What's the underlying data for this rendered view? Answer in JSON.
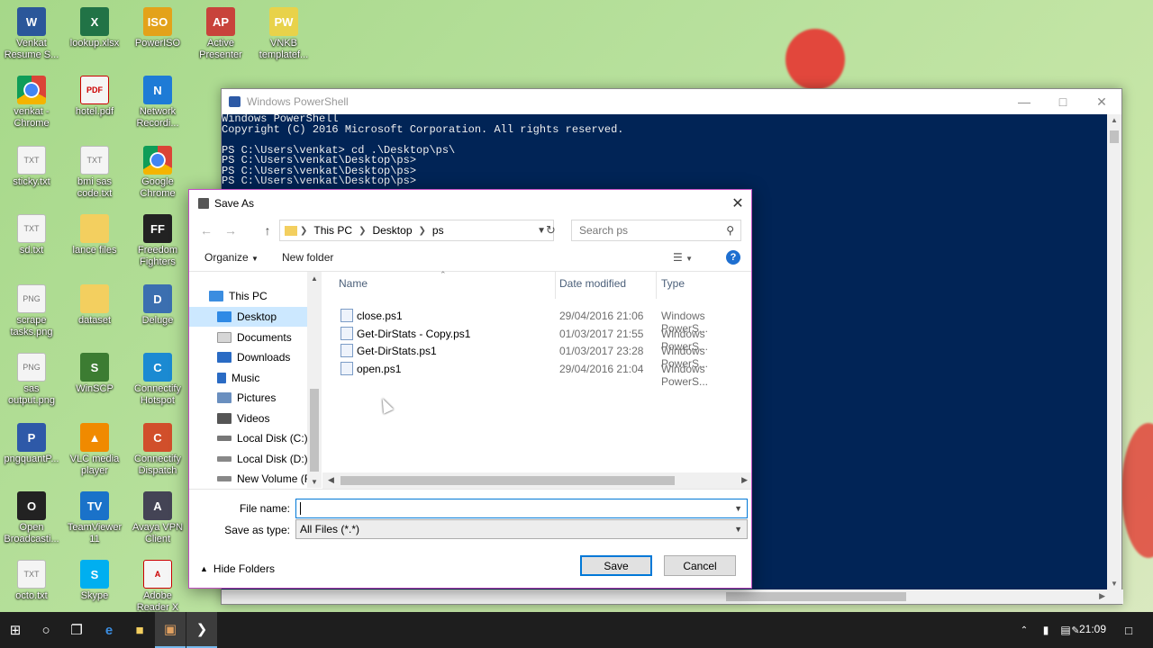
{
  "desktop": {
    "icons": [
      {
        "label": "Venkat Resume S...",
        "glyph": "W"
      },
      {
        "label": "lookup.xlsx",
        "glyph": "X"
      },
      {
        "label": "PowerISO",
        "glyph": "ISO"
      },
      {
        "label": "Active Presenter",
        "glyph": "AP"
      },
      {
        "label": "VNKB templatef...",
        "glyph": "PW"
      },
      {
        "label": "venkat - Chrome",
        "glyph": ""
      },
      {
        "label": "hotel.pdf",
        "glyph": "PDF"
      },
      {
        "label": "Network Recordi...",
        "glyph": "N"
      },
      {
        "label": "sticky.txt",
        "glyph": "TXT"
      },
      {
        "label": "bmi sas code.txt",
        "glyph": "TXT"
      },
      {
        "label": "Google Chrome",
        "glyph": ""
      },
      {
        "label": "sd.txt",
        "glyph": "TXT"
      },
      {
        "label": "lance files",
        "glyph": ""
      },
      {
        "label": "Freedom Fighters",
        "glyph": "FF"
      },
      {
        "label": "scrape tasks.png",
        "glyph": "PNG"
      },
      {
        "label": "dataset",
        "glyph": ""
      },
      {
        "label": "Deluge",
        "glyph": "D"
      },
      {
        "label": "sas output.png",
        "glyph": "PNG"
      },
      {
        "label": "WinSCP",
        "glyph": "S"
      },
      {
        "label": "Connectify Hotspot",
        "glyph": "C"
      },
      {
        "label": "pngquantP...",
        "glyph": "P"
      },
      {
        "label": "VLC media player",
        "glyph": "▲"
      },
      {
        "label": "Connectify Dispatch",
        "glyph": "C"
      },
      {
        "label": "Open Broadcasti...",
        "glyph": "O"
      },
      {
        "label": "TeamViewer 11",
        "glyph": "TV"
      },
      {
        "label": "Avaya VPN Client",
        "glyph": "A"
      },
      {
        "label": "octo.txt",
        "glyph": "TXT"
      },
      {
        "label": "Skype",
        "glyph": "S"
      },
      {
        "label": "Adobe Reader X",
        "glyph": "A"
      }
    ]
  },
  "powershell": {
    "title": "Windows PowerShell",
    "console_text": "Windows PowerShell\nCopyright (C) 2016 Microsoft Corporation. All rights reserved.\n\nPS C:\\Users\\venkat> cd .\\Desktop\\ps\\\nPS C:\\Users\\venkat\\Desktop\\ps>\nPS C:\\Users\\venkat\\Desktop\\ps>\nPS C:\\Users\\venkat\\Desktop\\ps>"
  },
  "dialog": {
    "title": "Save As",
    "breadcrumb": [
      "This PC",
      "Desktop",
      "ps"
    ],
    "search_placeholder": "Search ps",
    "organize_label": "Organize",
    "new_folder_label": "New folder",
    "nav_items": [
      "This PC",
      "Desktop",
      "Documents",
      "Downloads",
      "Music",
      "Pictures",
      "Videos",
      "Local Disk (C:)",
      "Local Disk (D:)",
      "New Volume (F:)"
    ],
    "columns": {
      "name": "Name",
      "date": "Date modified",
      "type": "Type"
    },
    "files": [
      {
        "name": "close.ps1",
        "date": "29/04/2016 21:06",
        "type": "Windows PowerS..."
      },
      {
        "name": "Get-DirStats - Copy.ps1",
        "date": "01/03/2017 21:55",
        "type": "Windows PowerS..."
      },
      {
        "name": "Get-DirStats.ps1",
        "date": "01/03/2017 23:28",
        "type": "Windows PowerS..."
      },
      {
        "name": "open.ps1",
        "date": "29/04/2016 21:04",
        "type": "Windows PowerS..."
      }
    ],
    "file_name_label": "File name:",
    "file_name_value": "",
    "save_type_label": "Save as type:",
    "save_type_value": "All Files (*.*)",
    "hide_folders_label": "Hide Folders",
    "save_label": "Save",
    "cancel_label": "Cancel"
  },
  "taskbar": {
    "clock": "21:09"
  }
}
